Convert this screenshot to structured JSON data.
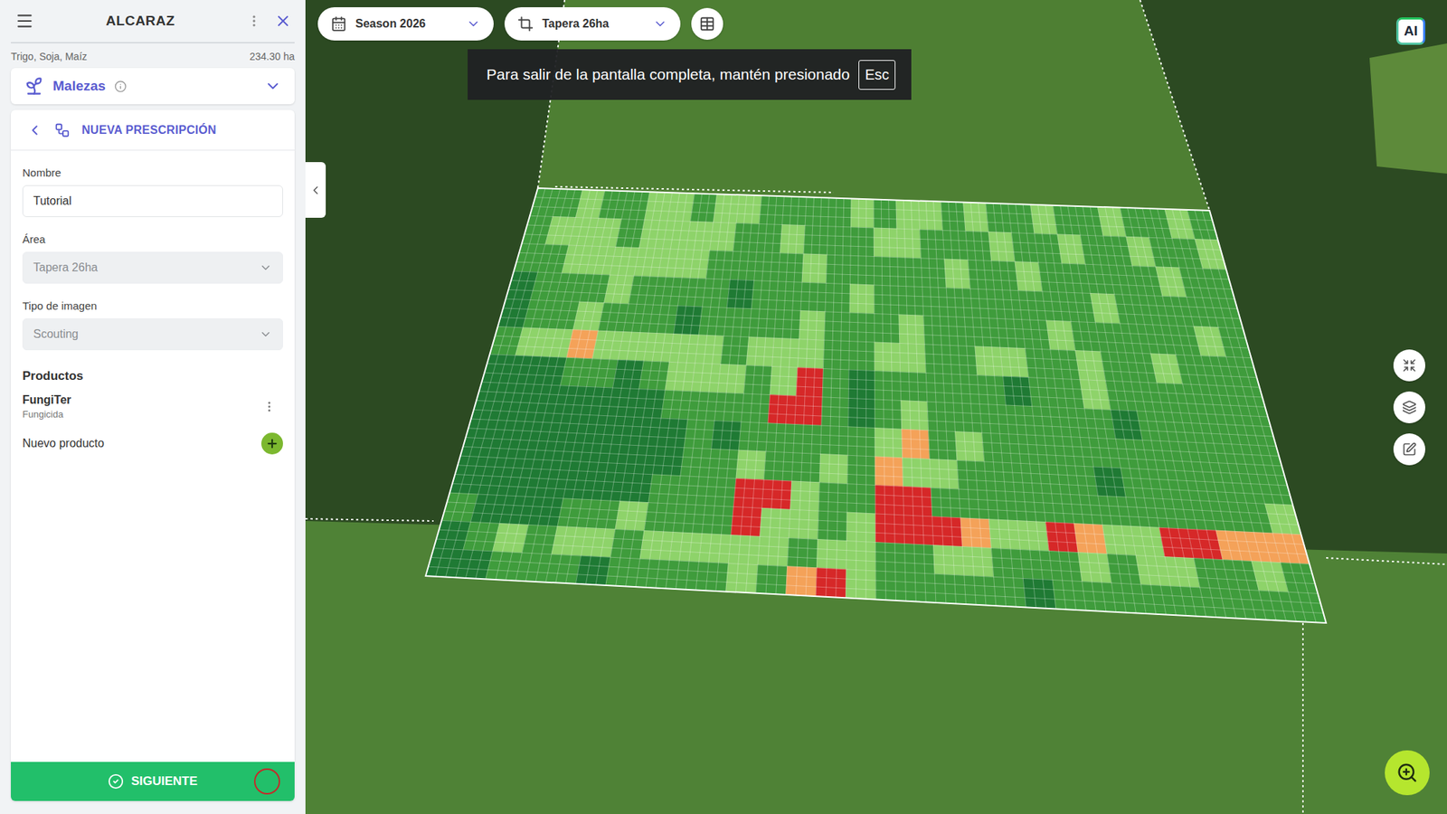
{
  "sidebar": {
    "title": "ALCARAZ",
    "crops": "Trigo, Soja, Maíz",
    "area": "234.30 ha",
    "layer": {
      "label": "Malezas",
      "expanded": false
    },
    "panel": {
      "title": "NUEVA PRESCRIPCIÓN",
      "fields": [
        {
          "label": "Nombre",
          "value": "Tutorial",
          "kind": "input",
          "disabled": false
        },
        {
          "label": "Área",
          "value": "Tapera 26ha",
          "kind": "select",
          "disabled": true
        },
        {
          "label": "Tipo de imagen",
          "value": "Scouting",
          "kind": "select",
          "disabled": true
        }
      ],
      "products_title": "Productos",
      "products": [
        {
          "name": "FungiTer",
          "type": "Fungicida"
        }
      ],
      "add_product": "Nuevo producto",
      "next_button": "SIGUIENTE"
    }
  },
  "toolbar": {
    "season": "Season 2026",
    "field": "Tapera 26ha"
  },
  "fullscreen_notice": {
    "text": "Para salir de la pantalla completa, mantén presionado",
    "key": "Esc"
  },
  "ai_badge": "AI",
  "heatmap": {
    "classes": [
      {
        "color": "#1f7a34"
      },
      {
        "color": "#3f9c3c"
      },
      {
        "color": "#8ed36a"
      },
      {
        "color": "#f4a259"
      },
      {
        "color": "#d62828"
      }
    ],
    "cells": [
      [
        1,
        1,
        2,
        1,
        1,
        2,
        2,
        1,
        2,
        2,
        1,
        1,
        1,
        1,
        2,
        1,
        2,
        2,
        1,
        2,
        1,
        1,
        2,
        1,
        1,
        2,
        1,
        1,
        2,
        1
      ],
      [
        1,
        2,
        2,
        2,
        1,
        2,
        2,
        2,
        2,
        1,
        1,
        2,
        1,
        1,
        1,
        2,
        2,
        1,
        1,
        1,
        2,
        1,
        1,
        2,
        1,
        1,
        2,
        1,
        1,
        2
      ],
      [
        1,
        1,
        2,
        2,
        2,
        2,
        2,
        2,
        1,
        1,
        1,
        1,
        2,
        1,
        1,
        1,
        1,
        1,
        2,
        1,
        1,
        2,
        1,
        1,
        1,
        1,
        1,
        2,
        1,
        1
      ],
      [
        0,
        1,
        1,
        1,
        2,
        1,
        1,
        1,
        1,
        0,
        1,
        1,
        1,
        1,
        2,
        1,
        1,
        1,
        1,
        1,
        1,
        1,
        1,
        1,
        2,
        1,
        1,
        1,
        1,
        1
      ],
      [
        0,
        1,
        1,
        2,
        1,
        1,
        1,
        0,
        1,
        1,
        1,
        1,
        2,
        1,
        1,
        1,
        2,
        1,
        1,
        1,
        1,
        1,
        2,
        1,
        1,
        1,
        1,
        1,
        2,
        1
      ],
      [
        1,
        2,
        2,
        3,
        2,
        2,
        2,
        2,
        2,
        1,
        2,
        2,
        2,
        1,
        1,
        2,
        2,
        1,
        1,
        2,
        2,
        1,
        1,
        2,
        1,
        1,
        2,
        1,
        1,
        1
      ],
      [
        0,
        0,
        0,
        1,
        1,
        0,
        1,
        2,
        2,
        2,
        1,
        2,
        4,
        1,
        0,
        1,
        1,
        1,
        1,
        1,
        0,
        1,
        1,
        2,
        1,
        1,
        1,
        1,
        1,
        1
      ],
      [
        0,
        0,
        0,
        0,
        0,
        0,
        0,
        1,
        1,
        1,
        1,
        4,
        4,
        1,
        0,
        1,
        2,
        1,
        1,
        1,
        1,
        1,
        1,
        1,
        0,
        1,
        1,
        1,
        1,
        1
      ],
      [
        0,
        0,
        0,
        0,
        0,
        0,
        0,
        0,
        1,
        0,
        1,
        1,
        1,
        1,
        1,
        2,
        3,
        1,
        2,
        1,
        1,
        1,
        1,
        1,
        1,
        1,
        1,
        1,
        1,
        1
      ],
      [
        0,
        0,
        0,
        0,
        0,
        0,
        0,
        0,
        1,
        1,
        2,
        1,
        1,
        2,
        1,
        3,
        2,
        2,
        1,
        1,
        1,
        1,
        1,
        0,
        1,
        1,
        1,
        1,
        1,
        1
      ],
      [
        0,
        0,
        0,
        0,
        0,
        0,
        0,
        1,
        1,
        1,
        4,
        4,
        2,
        1,
        1,
        4,
        4,
        1,
        1,
        1,
        1,
        1,
        1,
        1,
        1,
        1,
        1,
        1,
        1,
        2
      ],
      [
        1,
        0,
        0,
        0,
        1,
        1,
        2,
        1,
        1,
        1,
        4,
        2,
        2,
        1,
        2,
        4,
        4,
        4,
        3,
        2,
        2,
        4,
        3,
        2,
        2,
        4,
        4,
        3,
        3,
        3
      ],
      [
        0,
        1,
        2,
        1,
        2,
        2,
        1,
        2,
        2,
        2,
        2,
        2,
        1,
        2,
        2,
        1,
        1,
        2,
        2,
        1,
        1,
        1,
        2,
        1,
        2,
        2,
        1,
        1,
        2,
        1
      ],
      [
        0,
        0,
        1,
        1,
        1,
        0,
        1,
        1,
        1,
        1,
        2,
        1,
        3,
        4,
        2,
        1,
        1,
        1,
        1,
        1,
        0,
        1,
        1,
        1,
        1,
        1,
        1,
        1,
        1,
        1
      ]
    ]
  }
}
